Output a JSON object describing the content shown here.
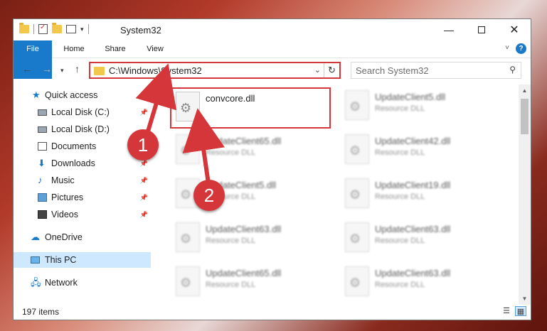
{
  "window": {
    "title": "System32",
    "controls": {
      "minimize": "—",
      "maximize": "",
      "close": "✕"
    }
  },
  "ribbon": {
    "tabs": [
      "File",
      "Home",
      "Share",
      "View"
    ],
    "help": "?"
  },
  "navbar": {
    "address": "C:\\Windows\\System32",
    "search_placeholder": "Search System32"
  },
  "sidebar": {
    "items": [
      {
        "label": "Quick access",
        "icon": "star-icon",
        "pinned": false
      },
      {
        "label": "Local Disk (C:)",
        "icon": "disk-icon",
        "pinned": true
      },
      {
        "label": "Local Disk (D:)",
        "icon": "disk-icon",
        "pinned": false
      },
      {
        "label": "Documents",
        "icon": "documents-icon",
        "pinned": true
      },
      {
        "label": "Downloads",
        "icon": "download-icon",
        "pinned": true
      },
      {
        "label": "Music",
        "icon": "music-icon",
        "pinned": true
      },
      {
        "label": "Pictures",
        "icon": "pictures-icon",
        "pinned": true
      },
      {
        "label": "Videos",
        "icon": "videos-icon",
        "pinned": true
      },
      {
        "label": "OneDrive",
        "icon": "cloud-icon",
        "pinned": false
      },
      {
        "label": "This PC",
        "icon": "pc-icon",
        "pinned": false,
        "selected": true
      },
      {
        "label": "Network",
        "icon": "network-icon",
        "pinned": false
      }
    ]
  },
  "files": {
    "left": [
      {
        "name": "convcore.dll",
        "type": ""
      },
      {
        "name": "UpdateClient65.dll",
        "type": "Resource DLL"
      },
      {
        "name": "UpdateClient5.dll",
        "type": "Resource DLL"
      },
      {
        "name": "UpdateClient63.dll",
        "type": "Resource DLL"
      },
      {
        "name": "UpdateClient65.dll",
        "type": "Resource DLL"
      }
    ],
    "right": [
      {
        "name": "UpdateClient5.dll",
        "type": "Resource DLL"
      },
      {
        "name": "UpdateClient42.dll",
        "type": "Resource DLL"
      },
      {
        "name": "UpdateClient19.dll",
        "type": "Resource DLL"
      },
      {
        "name": "UpdateClient63.dll",
        "type": "Resource DLL"
      },
      {
        "name": "UpdateClient63.dll",
        "type": "Resource DLL"
      }
    ]
  },
  "status": {
    "count": "197 items"
  },
  "annotations": {
    "badge1": "1",
    "badge2": "2"
  },
  "colors": {
    "accent": "#1979ca",
    "highlight": "#d5363a",
    "selected": "#cde8ff"
  }
}
